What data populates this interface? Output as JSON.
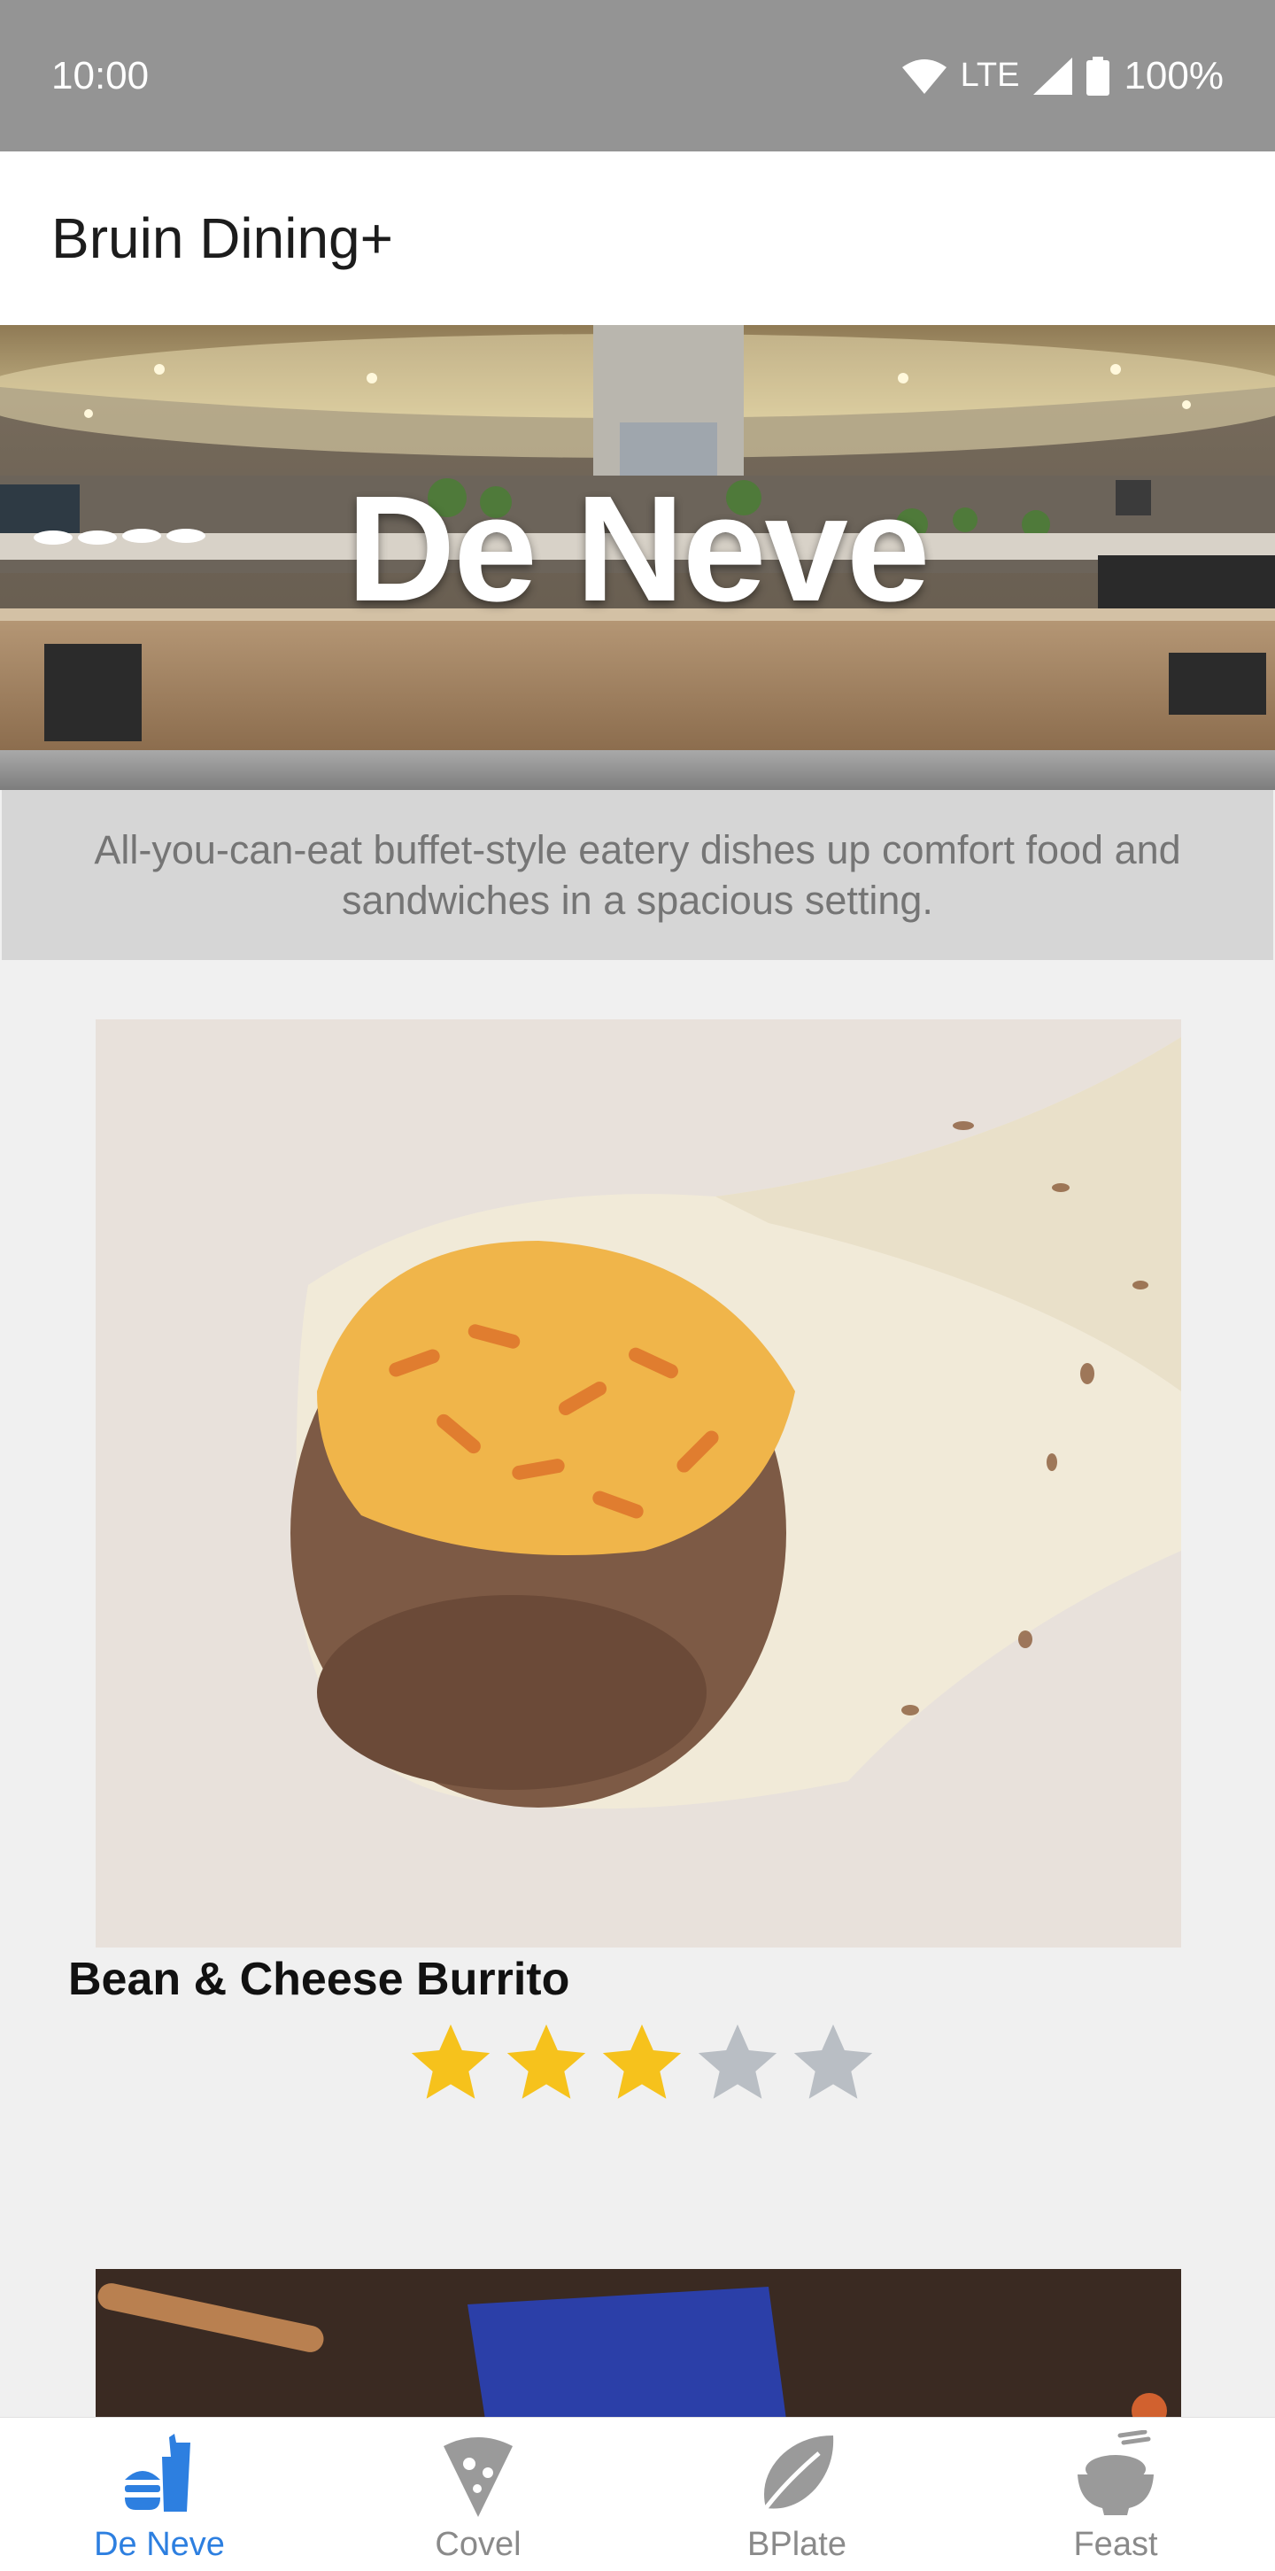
{
  "status_bar": {
    "time": "10:00",
    "network": "LTE",
    "battery": "100%",
    "icons": [
      "wifi-icon",
      "cell-signal-icon",
      "battery-icon"
    ]
  },
  "app_bar": {
    "title": "Bruin Dining+"
  },
  "hall": {
    "name": "De Neve",
    "description": "All-you-can-eat buffet-style eatery dishes up comfort food and sandwiches in a spacious setting."
  },
  "menu_items": [
    {
      "name": "Bean & Cheese Burrito",
      "rating": 3,
      "rating_max": 5
    }
  ],
  "bottom_nav": {
    "items": [
      {
        "label": "De Neve",
        "icon": "burger-drink-icon",
        "active": true
      },
      {
        "label": "Covel",
        "icon": "pizza-slice-icon",
        "active": false
      },
      {
        "label": "BPlate",
        "icon": "leaf-icon",
        "active": false
      },
      {
        "label": "Feast",
        "icon": "rice-bowl-icon",
        "active": false
      }
    ]
  },
  "colors": {
    "status_bar": "#949494",
    "star_filled": "#f6c21c",
    "star_empty": "#b9bec4",
    "nav_active": "#2d7fe0",
    "nav_inactive": "#8a8a8a"
  }
}
